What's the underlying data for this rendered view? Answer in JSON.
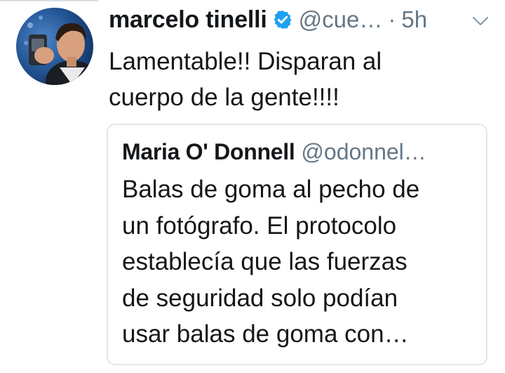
{
  "tweet": {
    "display_name": "marcelo tinelli",
    "handle": "@cue…",
    "separator": "·",
    "time": "5h",
    "text": "Lamentable!! Disparan al\ncuerpo de la gente!!!!",
    "verified": true,
    "icons": {
      "verified": "verified-badge-icon",
      "menu": "chevron-down-icon"
    }
  },
  "quoted_tweet": {
    "display_name": "Maria O' Donnell",
    "handle": "@odonnel…",
    "text": "Balas de goma al pecho de\nun fotógrafo. El protocolo\nestablecía que las fuerzas\nde seguridad solo podían\nusar balas de goma con…"
  },
  "colors": {
    "text_primary": "#14171a",
    "text_secondary": "#657786",
    "verified_blue": "#1da1f2",
    "card_border": "#e1e8ed"
  }
}
